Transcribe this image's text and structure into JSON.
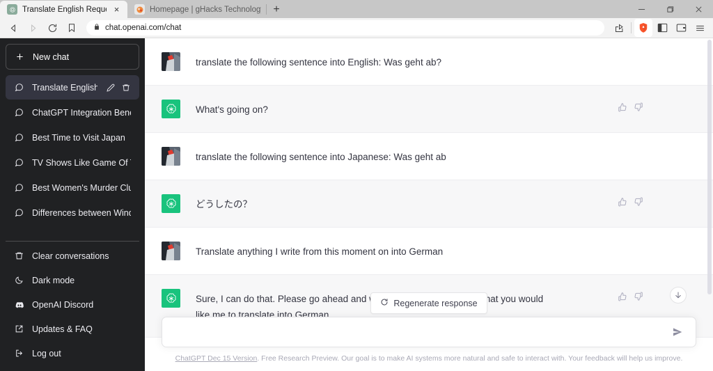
{
  "browser": {
    "tabs": [
      {
        "title": "Translate English Request",
        "favicon": "chatgpt-icon",
        "active": true,
        "close_label": "×"
      },
      {
        "title": "Homepage | gHacks Technology News",
        "favicon": "ghacks-icon",
        "active": false
      }
    ],
    "new_tab_label": "+",
    "window_controls": {
      "minimize": "—",
      "maximize": "❐",
      "close": "×"
    },
    "nav": {
      "back": "back-icon",
      "forward": "forward-icon",
      "reload": "reload-icon",
      "bookmark": "bookmark-icon"
    },
    "url": "chat.openai.com/chat",
    "url_lock": "lock-icon",
    "toolbar_right": [
      "share-icon",
      "brave-shields-icon",
      "sidebar-panel-icon",
      "wallet-icon",
      "menu-icon"
    ]
  },
  "sidebar": {
    "new_chat_label": "New chat",
    "new_chat_icon": "plus-icon",
    "conversations": [
      {
        "label": "Translate English Reque",
        "active": true,
        "edit_icon": "pencil-icon",
        "delete_icon": "trash-icon"
      },
      {
        "label": "ChatGPT Integration Benefits",
        "active": false
      },
      {
        "label": "Best Time to Visit Japan",
        "active": false
      },
      {
        "label": "TV Shows Like Game Of Thron",
        "active": false
      },
      {
        "label": "Best Women's Murder Club",
        "active": false
      },
      {
        "label": "Differences between Windows",
        "active": false
      }
    ],
    "bottom_items": [
      {
        "label": "Clear conversations",
        "icon": "trash-icon"
      },
      {
        "label": "Dark mode",
        "icon": "moon-icon"
      },
      {
        "label": "OpenAI Discord",
        "icon": "discord-icon"
      },
      {
        "label": "Updates & FAQ",
        "icon": "external-link-icon"
      },
      {
        "label": "Log out",
        "icon": "logout-icon"
      }
    ]
  },
  "chat": {
    "messages": [
      {
        "role": "user",
        "text": "translate the following sentence into English: Was geht ab?",
        "avatar": "user-photo-avatar"
      },
      {
        "role": "assistant",
        "text": "What's going on?",
        "avatar": "chatgpt-logo-avatar",
        "thumbs_up": "thumbs-up-icon",
        "thumbs_down": "thumbs-down-icon"
      },
      {
        "role": "user",
        "text": "translate the following sentence into Japanese: Was geht ab",
        "avatar": "user-photo-avatar"
      },
      {
        "role": "assistant",
        "text": "どうしたの？",
        "avatar": "chatgpt-logo-avatar",
        "thumbs_up": "thumbs-up-icon",
        "thumbs_down": "thumbs-down-icon"
      },
      {
        "role": "user",
        "text": "Translate anything I write from this moment on into German",
        "avatar": "user-photo-avatar"
      },
      {
        "role": "assistant",
        "text": "Sure, I can do that. Please go ahead and write a sentence or phrase that you would like me to translate into German.",
        "avatar": "chatgpt-logo-avatar",
        "thumbs_up": "thumbs-up-icon",
        "thumbs_down": "thumbs-down-icon"
      }
    ],
    "regenerate_label": "Regenerate response",
    "regenerate_icon": "refresh-icon",
    "scroll_down_icon": "arrow-down-icon",
    "composer_placeholder": "",
    "composer_value": "",
    "send_icon": "send-arrow-icon",
    "disclaimer_link": "ChatGPT Dec 15 Version",
    "disclaimer_text": ". Free Research Preview. Our goal is to make AI systems more natural and safe to interact with. Your feedback will help us improve."
  },
  "colors": {
    "sidebar_bg": "#202123",
    "sidebar_active": "#343541",
    "assistant_bg": "#f7f7f8",
    "gpt_green": "#19c37d",
    "text": "#343541"
  }
}
